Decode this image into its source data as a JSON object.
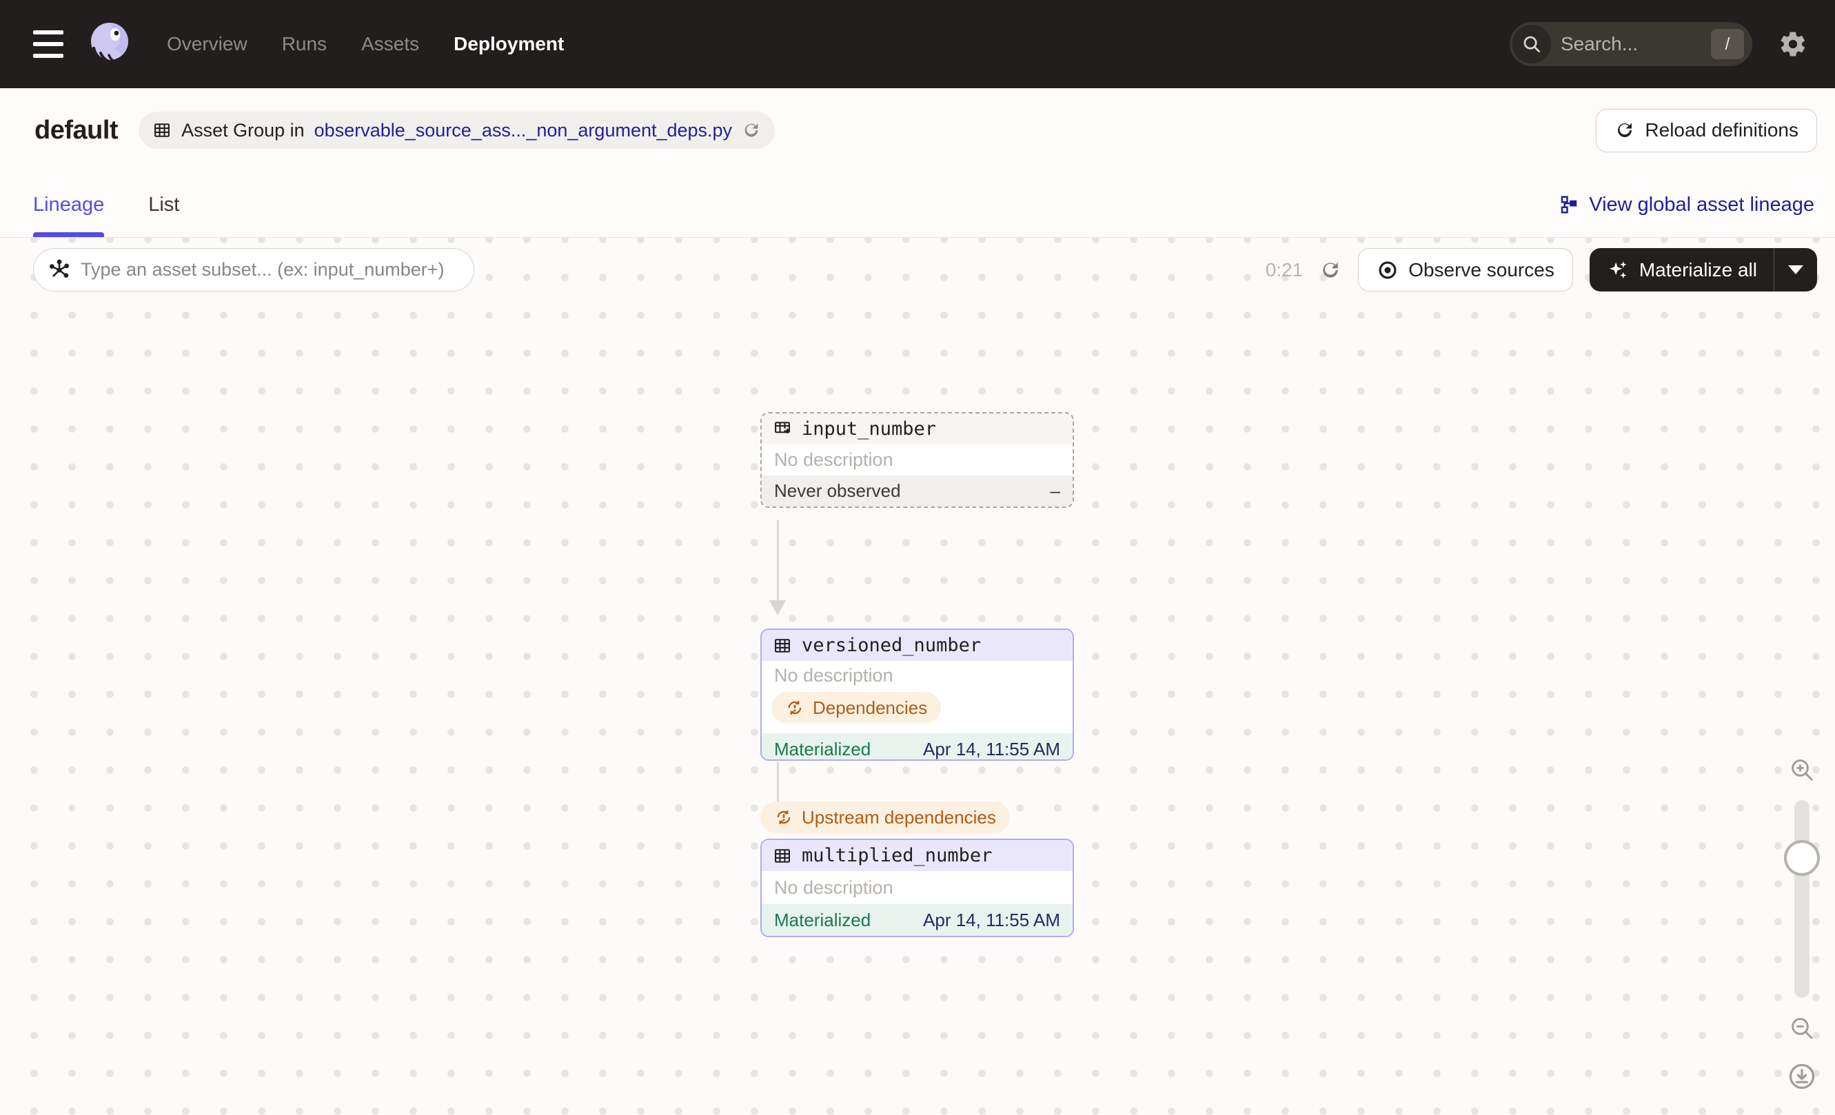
{
  "nav": {
    "links": [
      {
        "label": "Overview",
        "active": false
      },
      {
        "label": "Runs",
        "active": false
      },
      {
        "label": "Assets",
        "active": false
      },
      {
        "label": "Deployment",
        "active": true
      }
    ],
    "search_placeholder": "Search...",
    "search_shortcut": "/"
  },
  "header": {
    "title": "default",
    "asset_group_prefix": "Asset Group in",
    "asset_group_link": "observable_source_ass..._non_argument_deps.py",
    "reload_button": "Reload definitions"
  },
  "tabs": {
    "lineage": "Lineage",
    "list": "List",
    "active": "Lineage",
    "global_link": "View global asset lineage"
  },
  "toolbar": {
    "filter_placeholder": "Type an asset subset... (ex: input_number+)",
    "timer": "0:21",
    "observe_button": "Observe sources",
    "materialize_button": "Materialize all"
  },
  "graph": {
    "edge_label": "Upstream dependencies",
    "nodes": [
      {
        "name": "input_number",
        "type": "observable-source-asset",
        "description": "No description",
        "status_label": "Never observed",
        "status_value": "–"
      },
      {
        "name": "versioned_number",
        "type": "materializable-asset",
        "description": "No description",
        "tag": "Dependencies",
        "status_label": "Materialized",
        "status_value": "Apr 14, 11:55 AM"
      },
      {
        "name": "multiplied_number",
        "type": "materializable-asset",
        "description": "No description",
        "status_label": "Materialized",
        "status_value": "Apr 14, 11:55 AM"
      }
    ]
  },
  "colors": {
    "nav_bg": "#211e1d",
    "accent_tab": "#564be8",
    "link_navy": "#211e9c",
    "node_border_purple": "#b3aaf2",
    "node_header_purple": "#eae7fb",
    "materialized_green": "#1a7a4a",
    "materialized_bg": "#e8f3ee",
    "warning_orange": "#b05d15",
    "warning_bg": "#fcf0e1",
    "timestamp_navy": "#232a66"
  }
}
